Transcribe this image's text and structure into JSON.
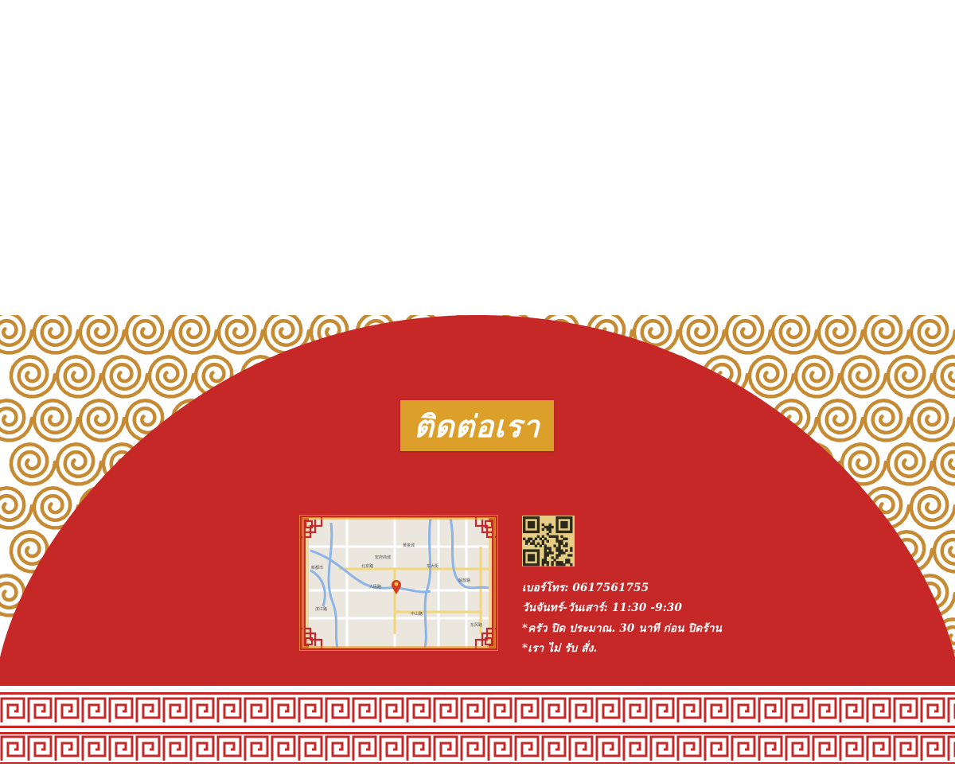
{
  "contact": {
    "title": "ติดต่อเรา",
    "phone_line": "เบอร์โทร: 0617561755",
    "hours_line": "วันจันทร์-วันเสาร์: 11:30 -9:30",
    "kitchen_line": "*ครัว ปิด ประมาณ. 30 นาที ก่อน ปิดร้าน",
    "no_order_line": "*เรา ไม่ รับ สั่ง."
  },
  "map": {
    "labels": [
      "黄金城",
      "新都市",
      "东大街",
      "北京路",
      "滨江路",
      "人民路",
      "解放路",
      "中山路",
      "宏府商城",
      "东风路"
    ]
  },
  "colors": {
    "red": "#c62828",
    "gold": "#dca02a",
    "swirl": "#c68a33",
    "white": "#ffffff"
  },
  "icons": [
    "map-pin-icon",
    "qr-code-icon"
  ]
}
